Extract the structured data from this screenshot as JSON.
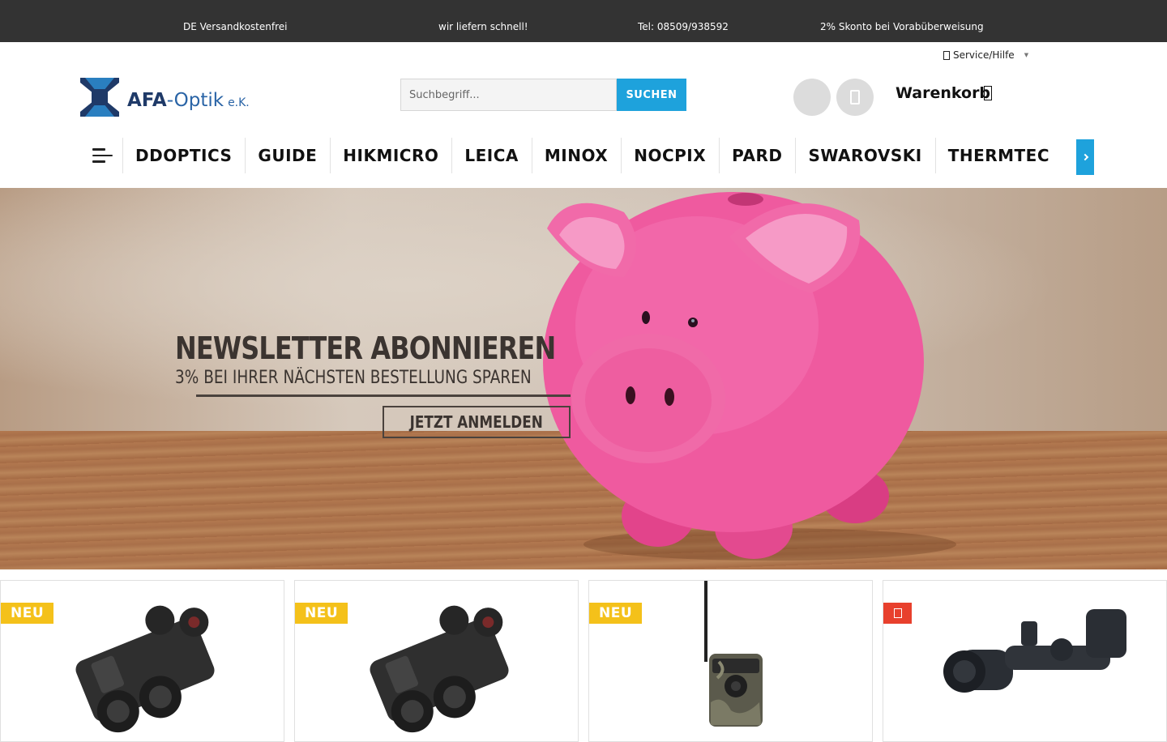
{
  "topbar": {
    "usp": [
      "DE Versandkostenfrei",
      "wir liefern schnell!",
      "Tel: 08509/938592",
      "2% Skonto bei Vorabüberweisung"
    ]
  },
  "header": {
    "service_label": "Service/Hilfe",
    "logo_text": "AFA",
    "logo_text_2": "-Optik",
    "logo_suffix": "e.K.",
    "search_placeholder": "Suchbegriff...",
    "search_button": "SUCHEN",
    "cart_label": "Warenkorb"
  },
  "nav": {
    "items": [
      "DDOPTICS",
      "GUIDE",
      "HIKMICRO",
      "LEICA",
      "MINOX",
      "NOCPIX",
      "PARD",
      "SWAROVSKI",
      "THERMTEC"
    ]
  },
  "hero": {
    "headline": "NEWSLETTER ABONNIEREN",
    "subline": "3% BEI IHRER NÄCHSTEN BESTELLUNG SPAREN",
    "cta": "JETZT ANMELDEN"
  },
  "products": {
    "badges": [
      "NEU",
      "NEU",
      "NEU"
    ]
  },
  "colors": {
    "accent": "#1ea2dc",
    "topbar": "#333333",
    "badge_new": "#f4c11a",
    "badge_sale": "#e8402d",
    "pig": "#f0589e"
  },
  "icons": [
    "menu-icon",
    "account-icon",
    "wishlist-icon",
    "cart-icon",
    "chevron-right-icon",
    "heart-icon"
  ]
}
